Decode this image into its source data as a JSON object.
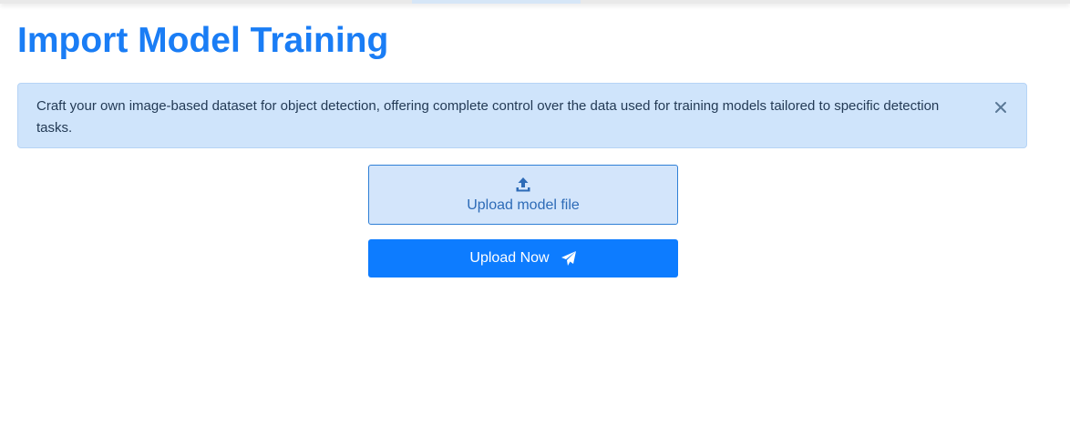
{
  "page": {
    "title": "Import Model Training"
  },
  "alert": {
    "message": "Craft your own image-based dataset for object detection, offering complete control over the data used for training models tailored to specific detection tasks.",
    "close_icon": "close-icon"
  },
  "upload": {
    "icon": "upload-icon",
    "label": "Upload model file"
  },
  "submit": {
    "label": "Upload Now",
    "icon": "paper-plane-icon"
  },
  "colors": {
    "accent": "#1a7df5",
    "button": "#0d7cff",
    "alert_bg": "#cfe4fb",
    "upload_bg": "#d3e5fb"
  }
}
